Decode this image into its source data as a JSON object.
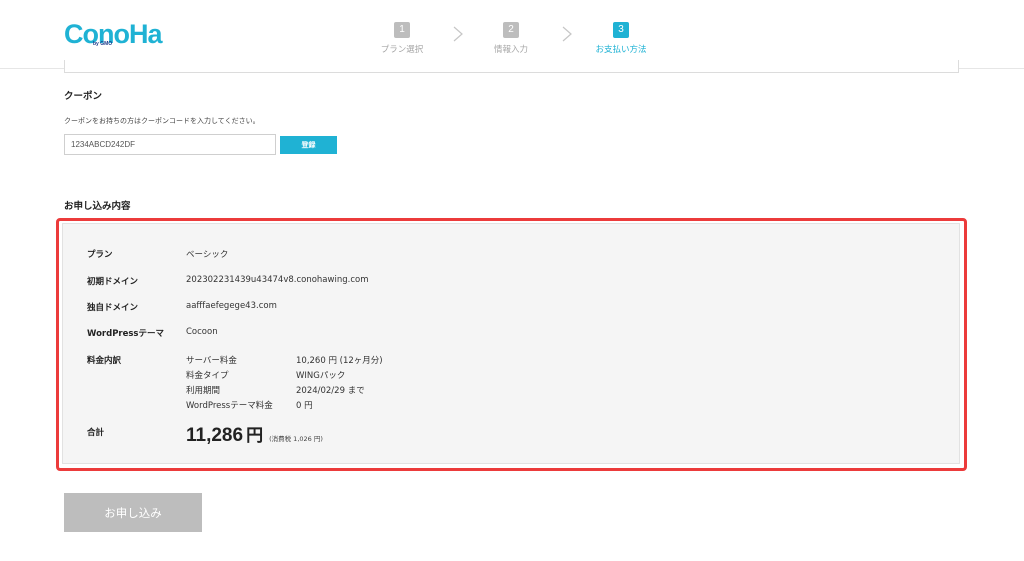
{
  "header": {
    "logo_text": "ConoHa",
    "logo_by": "by GMO",
    "steps": [
      {
        "number": "1",
        "label": "プラン選択"
      },
      {
        "number": "2",
        "label": "情報入力"
      },
      {
        "number": "3",
        "label": "お支払い方法"
      }
    ]
  },
  "coupon": {
    "title": "クーポン",
    "description": "クーポンをお持ちの方はクーポンコードを入力してください。",
    "input_value": "1234ABCD242DF",
    "button_label": "登録"
  },
  "summary": {
    "title": "お申し込み内容",
    "rows": [
      {
        "label": "プラン",
        "value": "ベーシック"
      },
      {
        "label": "初期ドメイン",
        "value": "202302231439u43474v8.conohawing.com"
      },
      {
        "label": "独自ドメイン",
        "value": "aafffaefegege43.com"
      },
      {
        "label": "WordPressテーマ",
        "value": "Cocoon"
      }
    ],
    "breakdown_label": "料金内訳",
    "breakdown": [
      {
        "label": "サーバー料金",
        "value": "10,260 円 (12ヶ月分)"
      },
      {
        "label": "料金タイプ",
        "value": "WINGパック"
      },
      {
        "label": "利用期間",
        "value": "2024/02/29 まで"
      },
      {
        "label": "WordPressテーマ料金",
        "value": "0 円"
      }
    ],
    "total_label": "合計",
    "total_amount": "11,286",
    "total_currency": "円",
    "total_tax": "(消費税 1,026 円)"
  },
  "submit": {
    "label": "お申し込み"
  },
  "colors": {
    "accent": "#1fb2d4",
    "highlight_border": "#ec3b3b",
    "disabled": "#bdbdbd"
  }
}
